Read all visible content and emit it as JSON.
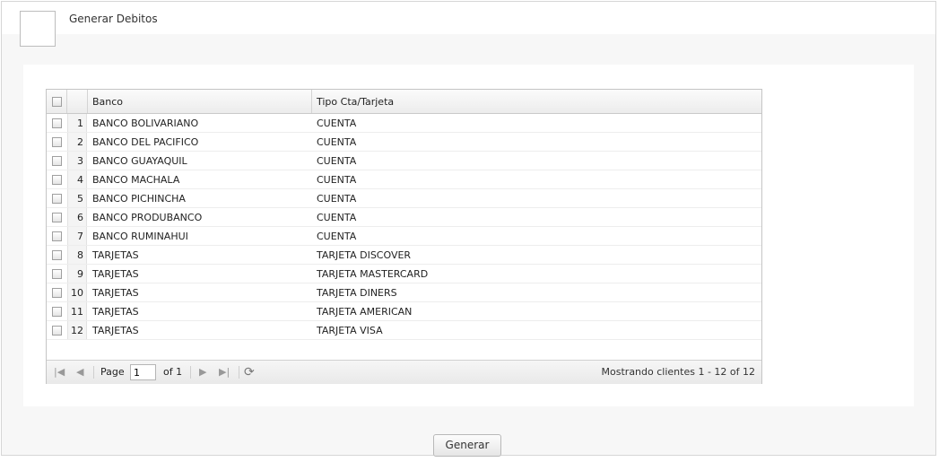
{
  "header": {
    "title": "Generar Debitos"
  },
  "grid": {
    "columns": [
      "Banco",
      "Tipo Cta/Tarjeta"
    ],
    "rows": [
      {
        "n": "1",
        "banco": "BANCO BOLIVARIANO",
        "tipo": "CUENTA"
      },
      {
        "n": "2",
        "banco": "BANCO DEL PACIFICO",
        "tipo": "CUENTA"
      },
      {
        "n": "3",
        "banco": "BANCO GUAYAQUIL",
        "tipo": "CUENTA"
      },
      {
        "n": "4",
        "banco": "BANCO MACHALA",
        "tipo": "CUENTA"
      },
      {
        "n": "5",
        "banco": "BANCO PICHINCHA",
        "tipo": "CUENTA"
      },
      {
        "n": "6",
        "banco": "BANCO PRODUBANCO",
        "tipo": "CUENTA"
      },
      {
        "n": "7",
        "banco": "BANCO RUMINAHUI",
        "tipo": "CUENTA"
      },
      {
        "n": "8",
        "banco": "TARJETAS",
        "tipo": "TARJETA DISCOVER"
      },
      {
        "n": "9",
        "banco": "TARJETAS",
        "tipo": "TARJETA MASTERCARD"
      },
      {
        "n": "10",
        "banco": "TARJETAS",
        "tipo": "TARJETA DINERS"
      },
      {
        "n": "11",
        "banco": "TARJETAS",
        "tipo": "TARJETA AMERICAN"
      },
      {
        "n": "12",
        "banco": "TARJETAS",
        "tipo": "TARJETA VISA"
      }
    ]
  },
  "pager": {
    "page_label": "Page",
    "page_value": "1",
    "of_label": "of 1",
    "status": "Mostrando clientes 1 - 12 of 12"
  },
  "actions": {
    "generar_label": "Generar"
  }
}
